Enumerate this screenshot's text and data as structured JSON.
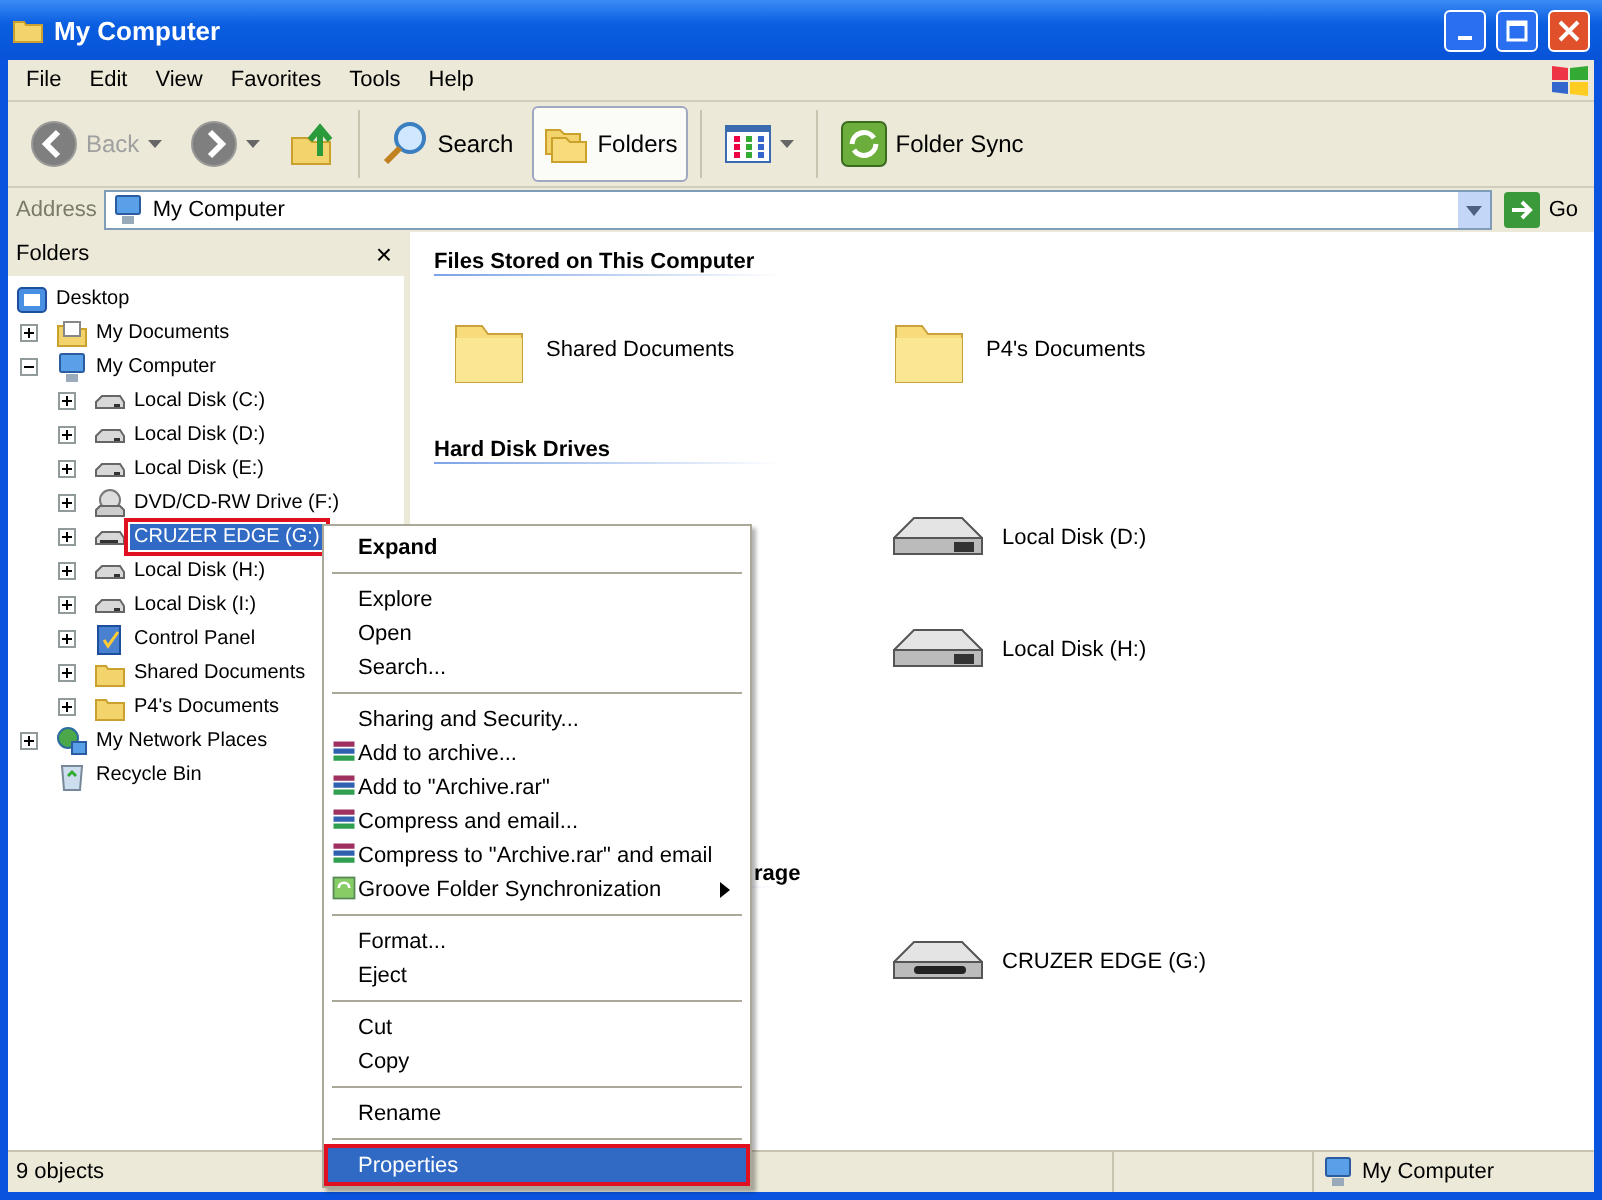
{
  "window": {
    "title": "My Computer"
  },
  "menu_bar": [
    "File",
    "Edit",
    "View",
    "Favorites",
    "Tools",
    "Help"
  ],
  "toolbar": [
    {
      "kind": "back",
      "label": "Back",
      "disabled": true
    },
    {
      "kind": "forward",
      "disabled": true
    },
    {
      "kind": "up",
      "disabled": false
    },
    {
      "kind": "search",
      "label": "Search",
      "disabled": false
    },
    {
      "kind": "folders",
      "label": "Folders",
      "disabled": false,
      "selected": true
    },
    {
      "kind": "views",
      "disabled": false
    },
    {
      "kind": "sync",
      "label": "Folder Sync",
      "disabled": false
    }
  ],
  "address_bar": {
    "label": "Address",
    "value": "My Computer",
    "go": "Go"
  },
  "folders_pane": {
    "title": "Folders",
    "close": "×",
    "tree": [
      {
        "label": "Desktop",
        "kind": "desktop",
        "has_toggle": false,
        "selected": false,
        "children": [
          {
            "label": "My Documents",
            "kind": "documents",
            "has_toggle": true,
            "expanded": false,
            "selected": false
          },
          {
            "label": "My Computer",
            "kind": "computer",
            "has_toggle": true,
            "expanded": true,
            "selected": false,
            "children": [
              {
                "label": "Local Disk (C:)",
                "kind": "disk",
                "has_toggle": true,
                "expanded": false,
                "selected": false
              },
              {
                "label": "Local Disk (D:)",
                "kind": "disk",
                "has_toggle": true,
                "expanded": false,
                "selected": false
              },
              {
                "label": "Local Disk (E:)",
                "kind": "disk",
                "has_toggle": true,
                "expanded": false,
                "selected": false
              },
              {
                "label": "DVD/CD-RW Drive (F:)",
                "kind": "cd",
                "has_toggle": true,
                "expanded": false,
                "selected": false
              },
              {
                "label": "CRUZER EDGE (G:)",
                "kind": "usb",
                "has_toggle": true,
                "expanded": false,
                "selected": true
              },
              {
                "label": "Local Disk (H:)",
                "kind": "disk",
                "has_toggle": true,
                "expanded": false,
                "selected": false
              },
              {
                "label": "Local Disk (I:)",
                "kind": "disk",
                "has_toggle": true,
                "expanded": false,
                "selected": false
              },
              {
                "label": "Control Panel",
                "kind": "control",
                "has_toggle": true,
                "expanded": false,
                "selected": false
              },
              {
                "label": "Shared Documents",
                "kind": "folder",
                "has_toggle": true,
                "expanded": false,
                "selected": false
              },
              {
                "label": "P4's Documents",
                "kind": "folder",
                "has_toggle": true,
                "expanded": false,
                "selected": false
              }
            ]
          },
          {
            "label": "My Network Places",
            "kind": "network",
            "has_toggle": true,
            "expanded": false,
            "selected": false
          },
          {
            "label": "Recycle Bin",
            "kind": "recycle",
            "has_toggle": false,
            "selected": false
          }
        ]
      }
    ]
  },
  "content": {
    "groups": [
      {
        "heading": "Files Stored on This Computer",
        "heading_covered": false,
        "left_covered": false,
        "items": [
          {
            "label": "Shared Documents",
            "kind": "folder"
          },
          {
            "label": "P4's Documents",
            "kind": "folder"
          }
        ]
      },
      {
        "heading": "Hard Disk Drives",
        "heading_covered": false,
        "left_covered": true,
        "items": [
          {
            "label": "Local Disk (D:)",
            "kind": "disk"
          },
          {
            "label": "Local Disk (H:)",
            "kind": "disk"
          }
        ]
      },
      {
        "heading": "rage",
        "heading_covered": true,
        "left_covered": true,
        "items": [
          {
            "label": "CRUZER EDGE (G:)",
            "kind": "usb"
          }
        ]
      }
    ]
  },
  "context_menu": [
    {
      "label": "Expand",
      "kind": "default",
      "selected": false
    },
    {
      "kind": "separator"
    },
    {
      "label": "Explore",
      "kind": "plain",
      "selected": false
    },
    {
      "label": "Open",
      "kind": "plain",
      "selected": false
    },
    {
      "label": "Search...",
      "kind": "plain",
      "selected": false
    },
    {
      "kind": "separator"
    },
    {
      "label": "Sharing and Security...",
      "kind": "plain",
      "selected": false
    },
    {
      "label": "Add to archive...",
      "kind": "rar",
      "selected": false
    },
    {
      "label": "Add to \"Archive.rar\"",
      "kind": "rar",
      "selected": false
    },
    {
      "label": "Compress and email...",
      "kind": "rar",
      "selected": false
    },
    {
      "label": "Compress to \"Archive.rar\" and email",
      "kind": "rar",
      "selected": false
    },
    {
      "label": "Groove Folder Synchronization",
      "kind": "submenu",
      "selected": false
    },
    {
      "kind": "separator"
    },
    {
      "label": "Format...",
      "kind": "plain",
      "selected": false
    },
    {
      "label": "Eject",
      "kind": "plain",
      "selected": false
    },
    {
      "kind": "separator"
    },
    {
      "label": "Cut",
      "kind": "plain",
      "selected": false
    },
    {
      "label": "Copy",
      "kind": "plain",
      "selected": false
    },
    {
      "kind": "separator"
    },
    {
      "label": "Rename",
      "kind": "plain",
      "selected": false
    },
    {
      "kind": "separator"
    },
    {
      "label": "Properties",
      "kind": "plain",
      "selected": true
    }
  ],
  "status_bar": {
    "count": "9 objects",
    "location": "My Computer"
  }
}
